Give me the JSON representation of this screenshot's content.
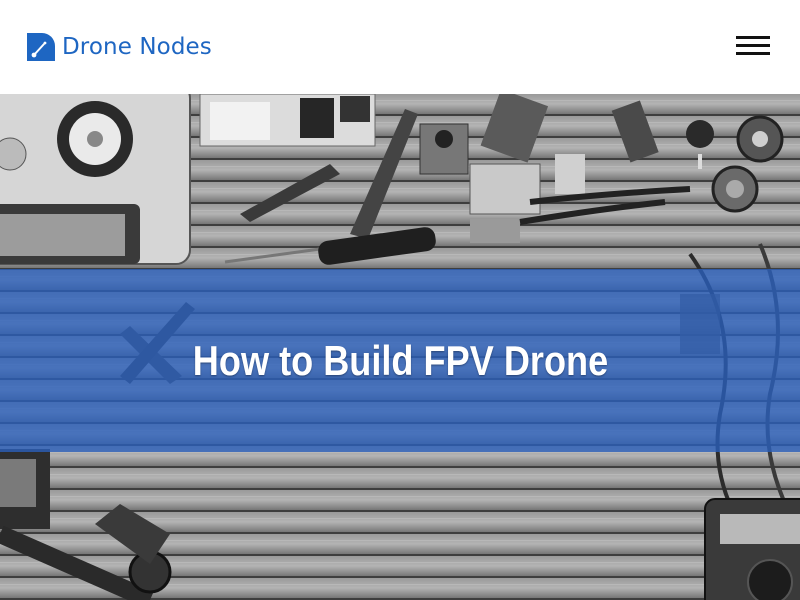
{
  "header": {
    "brand": "Drone Nodes",
    "brand_color": "#1e66c2",
    "logo_icon": "drone-nodes-logo-icon",
    "menu_icon": "hamburger-menu-icon"
  },
  "hero": {
    "title": "How to Build FPV Drone",
    "band_color": "#2a60be",
    "background": "grayscale photo of drone parts on wooden slat table"
  }
}
